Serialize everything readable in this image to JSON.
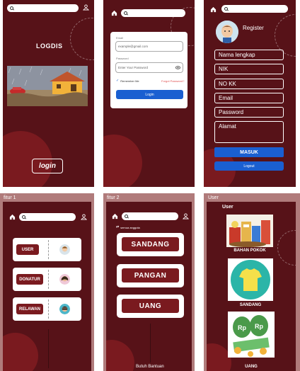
{
  "screens": {
    "splash": {
      "logo": "LOGDIS",
      "login_button": "login"
    },
    "login": {
      "email_label": "Email",
      "email_placeholder": "example@gmail.com",
      "password_label": "Password",
      "password_placeholder": "Enter Your Password",
      "remember_me": "Remember Me",
      "forgot_password": "Forgot Password?",
      "login_button": "Login"
    },
    "register": {
      "title": "Register",
      "fields": [
        "Nama lengkap",
        "NIK",
        "NO KK",
        "Email",
        "Password"
      ],
      "address_field": "Alamat",
      "masuk_button": "MASUK",
      "logout_button": "Logout"
    },
    "fitur1": {
      "frame_label": "fitur 1",
      "roles": [
        "USER",
        "DONATUR",
        "RELAWAN"
      ]
    },
    "fitur2": {
      "frame_label": "fitur 2",
      "filter_text": "semua anggota",
      "categories": [
        "SANDANG",
        "PANGAN",
        "UANG"
      ],
      "bottom_text": "Butuh Bantuan"
    },
    "user": {
      "frame_label": "User",
      "title": "User",
      "items": [
        "BAHAN POKOK",
        "SANDANG",
        "UANG"
      ]
    }
  },
  "colors": {
    "frame_bg": "#571218",
    "accent_blob": "#7a1a1f",
    "primary_blue": "#1a5fd1",
    "frame_border": "#b07b7b"
  },
  "icons": [
    "search-icon",
    "home-icon",
    "user-icon",
    "eye-icon",
    "check-icon",
    "filter-icon"
  ]
}
